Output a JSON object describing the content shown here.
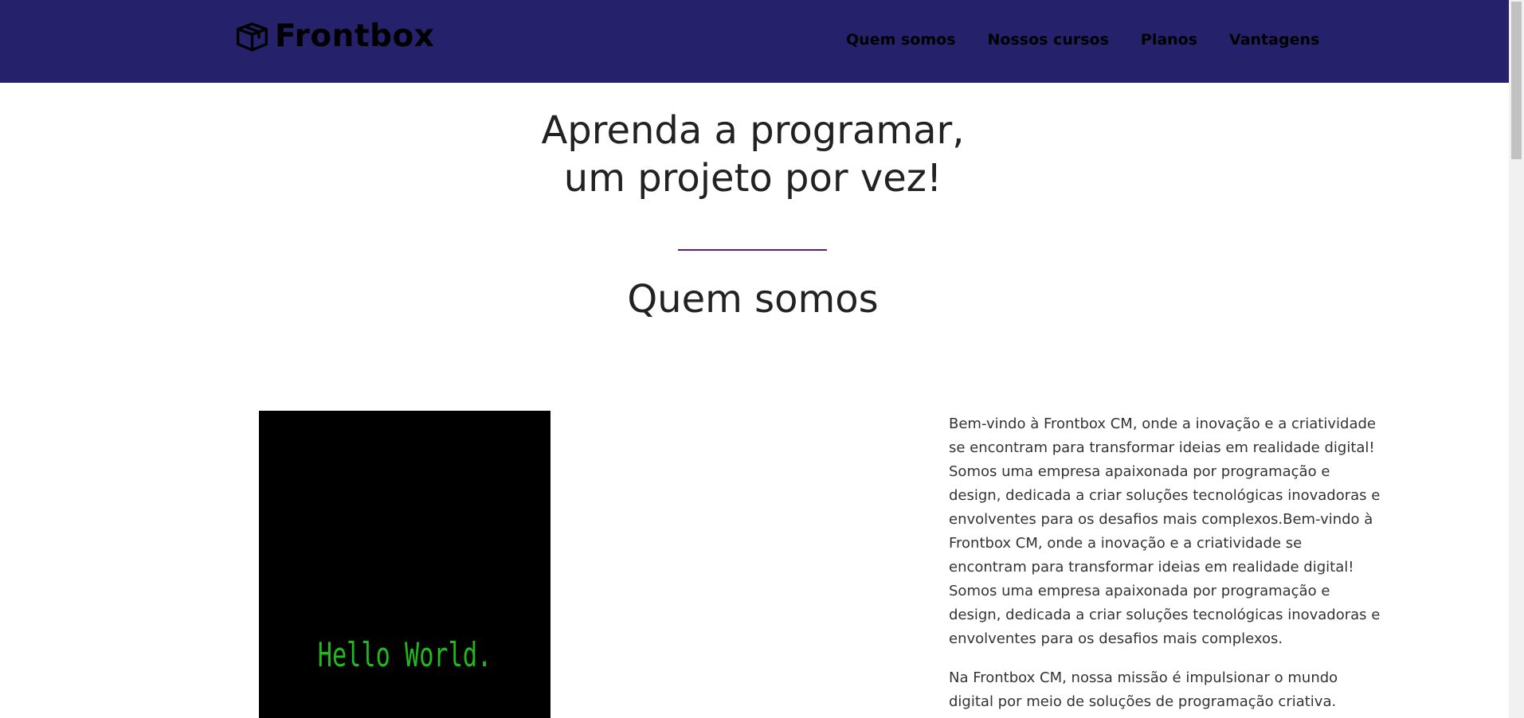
{
  "navbar": {
    "brand": "Frontbox",
    "brand_icon": "box-icon",
    "background": "#25216a",
    "links": [
      {
        "label": "Quem somos"
      },
      {
        "label": "Nossos cursos"
      },
      {
        "label": "Planos"
      },
      {
        "label": "Vantagens"
      }
    ]
  },
  "hero": {
    "title_line1": "Aprenda a programar,",
    "title_line2": "um projeto por vez!",
    "divider_color": "#5b1f78"
  },
  "about": {
    "title": "Quem somos",
    "media_text": "Hello World.",
    "media_text_color": "#22b81f",
    "paragraphs": [
      "Bem-vindo à Frontbox CM, onde a inovação e a criatividade se encontram para transformar ideias em realidade digital! Somos uma empresa apaixonada por programação e design, dedicada a criar soluções tecnológicas inovadoras e envolventes para os desafios mais complexos.Bem-vindo à Frontbox CM, onde a inovação e a criatividade se encontram para transformar ideias em realidade digital! Somos uma empresa apaixonada por programação e design, dedicada a criar soluções tecnológicas inovadoras e envolventes para os desafios mais complexos.",
      "Na Frontbox CM, nossa missão é impulsionar o mundo digital por meio de soluções de programação criativa."
    ]
  }
}
